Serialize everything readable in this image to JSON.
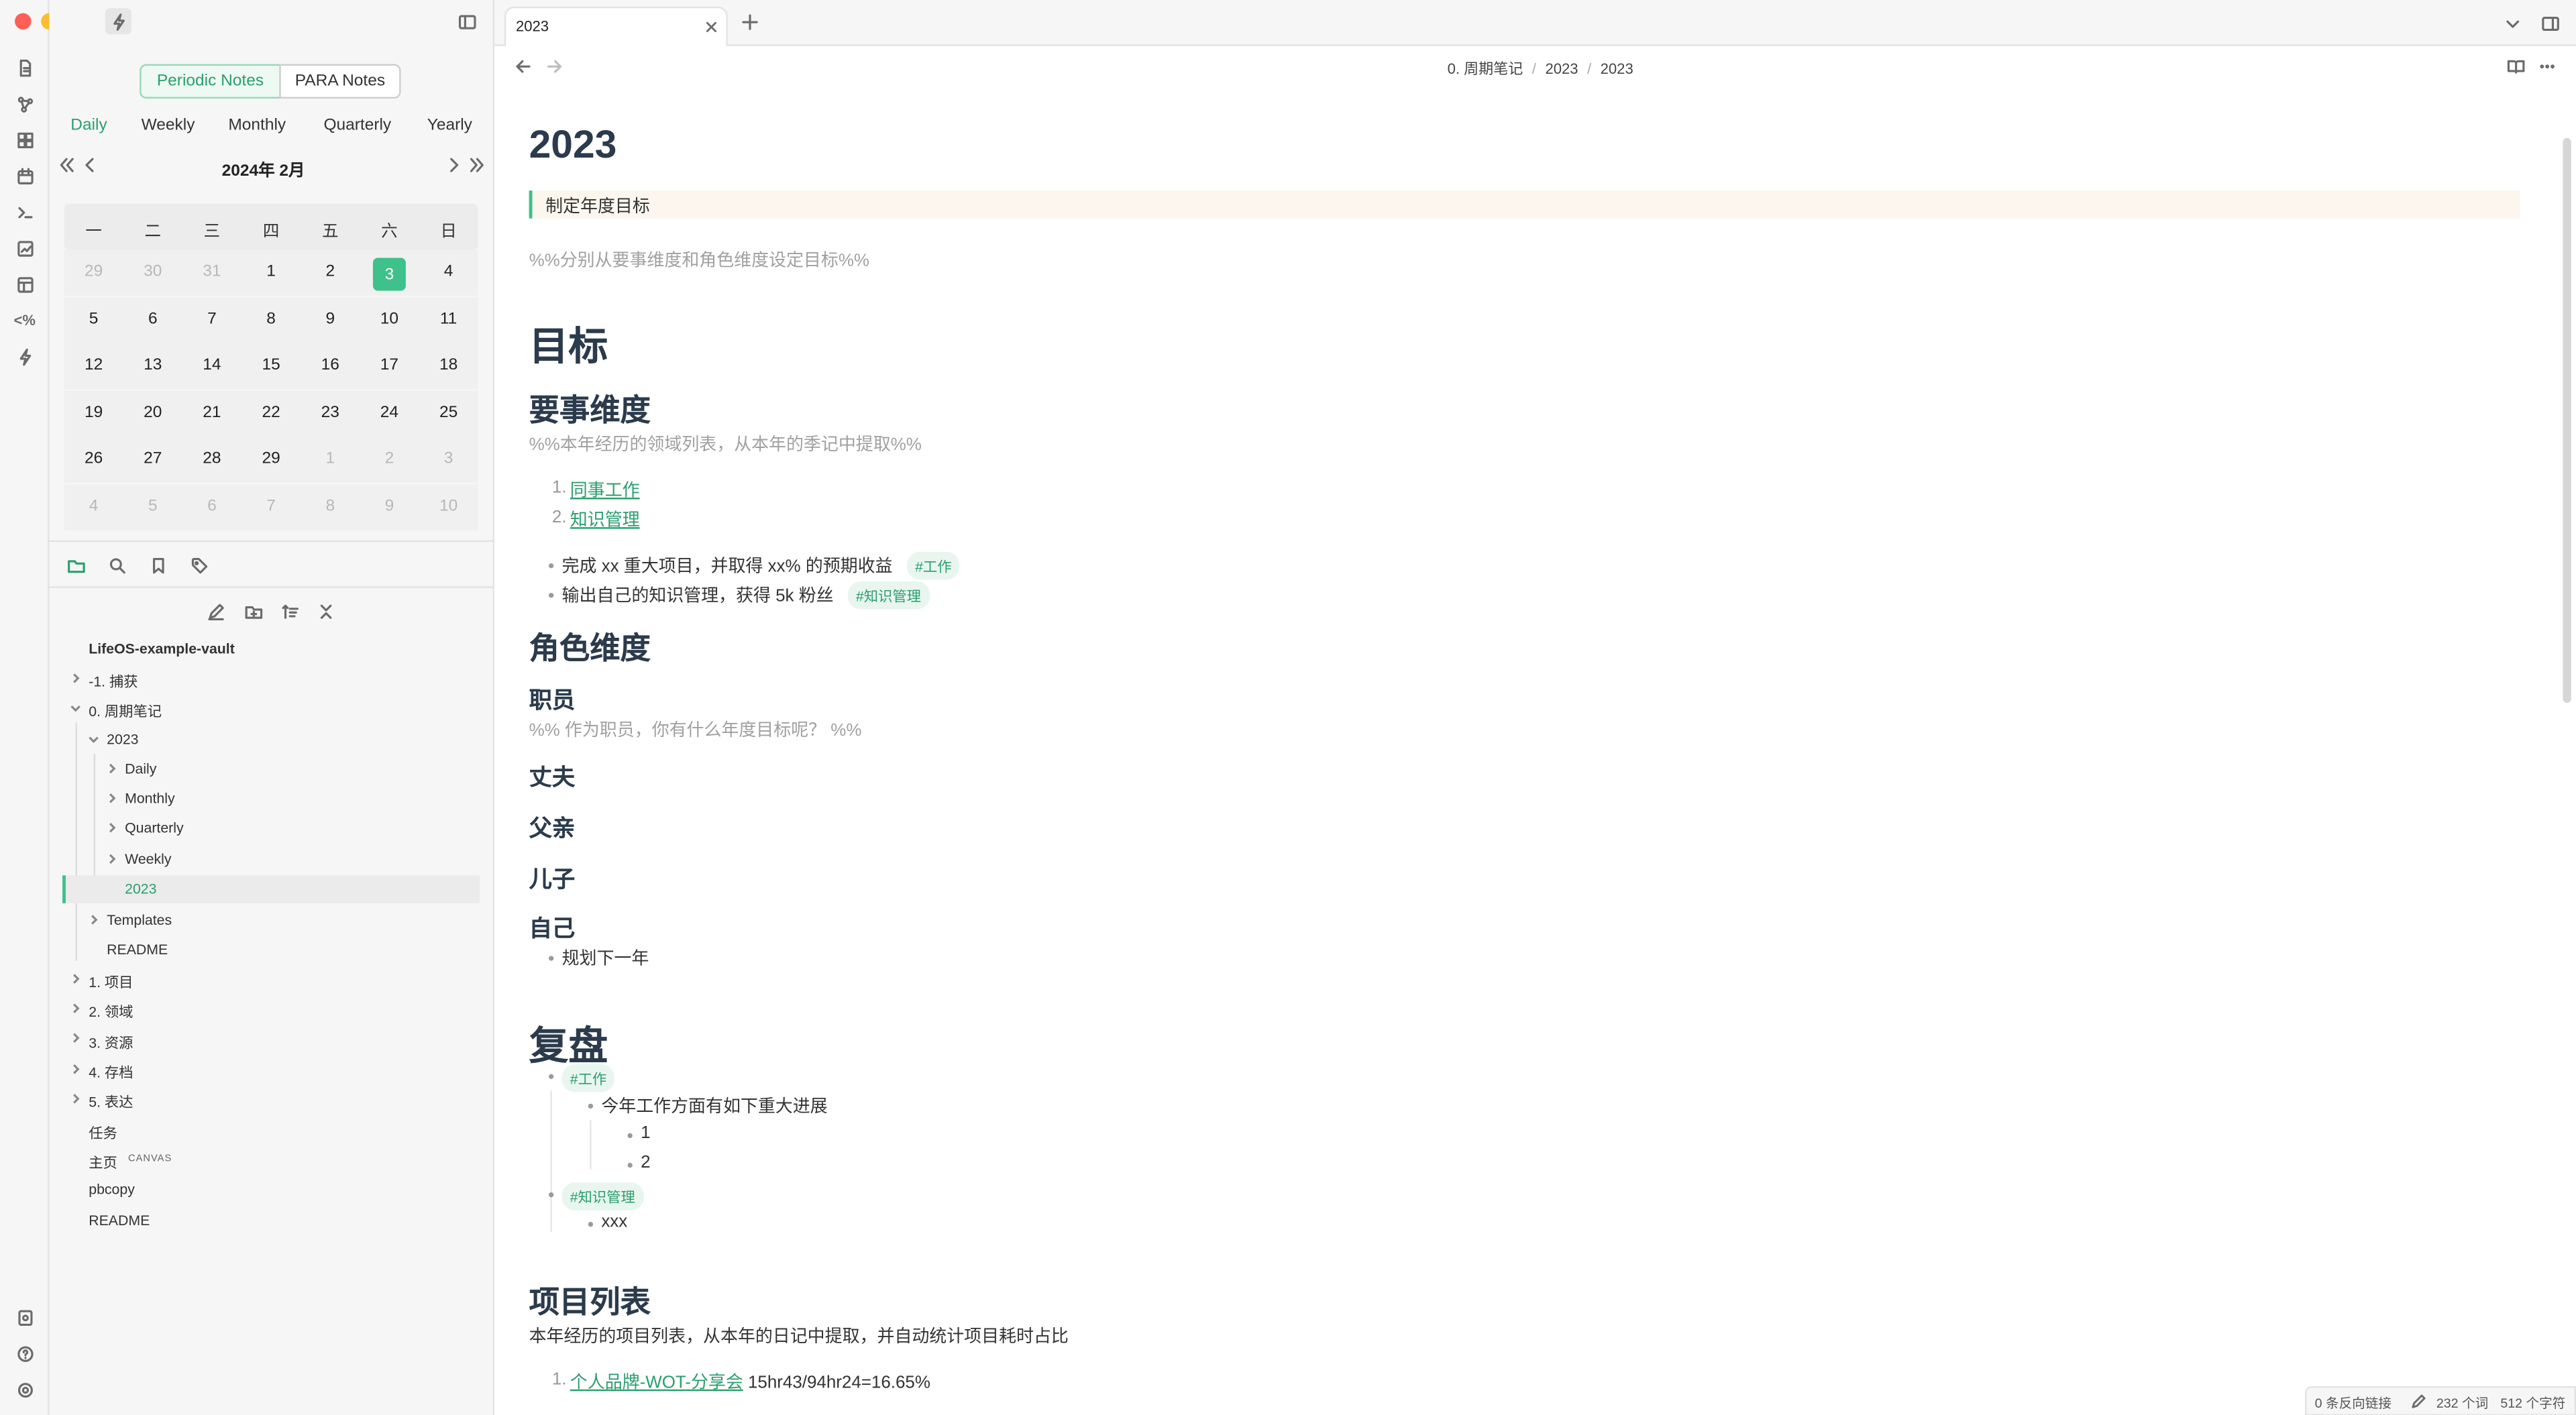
{
  "sidebar": {
    "view_toggle": [
      "Periodic Notes",
      "PARA Notes"
    ],
    "periods": [
      "Daily",
      "Weekly",
      "Monthly",
      "Quarterly",
      "Yearly"
    ],
    "calendar": {
      "month_label": "2024年  2月",
      "weekdays": [
        "一",
        "二",
        "三",
        "四",
        "五",
        "六",
        "日"
      ],
      "weeks": [
        [
          "29",
          "30",
          "31",
          "1",
          "2",
          "3",
          "4"
        ],
        [
          "5",
          "6",
          "7",
          "8",
          "9",
          "10",
          "11"
        ],
        [
          "12",
          "13",
          "14",
          "15",
          "16",
          "17",
          "18"
        ],
        [
          "19",
          "20",
          "21",
          "22",
          "23",
          "24",
          "25"
        ],
        [
          "26",
          "27",
          "28",
          "29",
          "1",
          "2",
          "3"
        ],
        [
          "4",
          "5",
          "6",
          "7",
          "8",
          "9",
          "10"
        ]
      ],
      "today": "3"
    },
    "tree": {
      "vault": "LifeOS-example-vault",
      "capture": "-1. 捕获",
      "periodic": "0. 周期笔记",
      "year_folder": "2023",
      "daily": "Daily",
      "monthly": "Monthly",
      "quarterly": "Quarterly",
      "weekly": "Weekly",
      "year_note": "2023",
      "templates": "Templates",
      "readme_inner": "README",
      "projects": "1. 项目",
      "areas": "2. 领域",
      "resources": "3. 资源",
      "archive": "4. 存档",
      "express": "5. 表达",
      "tasks": "任务",
      "home": "主页",
      "canvas_badge": "CANVAS",
      "pbcopy": "pbcopy",
      "readme": "README"
    }
  },
  "tabs": {
    "active": "2023"
  },
  "breadcrumb": [
    "0. 周期笔记",
    "2023",
    "2023"
  ],
  "doc": {
    "title": "2023",
    "callout": "制定年度目标",
    "comment1": "%%分别从要事维度和角色维度设定目标%%",
    "h_goals": "目标",
    "h_key": "要事维度",
    "comment2": "%%本年经历的领域列表，从本年的季记中提取%%",
    "ol1": "同事工作",
    "ol2": "知识管理",
    "bullet1": "完成 xx 重大项目，并取得 xx% 的预期收益",
    "tag_work": "#工作",
    "bullet2": "输出自己的知识管理，获得 5k 粉丝",
    "tag_km": "#知识管理",
    "h_role": "角色维度",
    "role_staff": "职员",
    "comment3": "%% 作为职员，你有什么年度目标呢？ %%",
    "role_husband": "丈夫",
    "role_father": "父亲",
    "role_son": "儿子",
    "role_self": "自己",
    "self_bullet": "规划下一年",
    "h_review": "复盘",
    "review_tag1": "#工作",
    "review_text1": "今年工作方面有如下重大进展",
    "review_n1": "1",
    "review_n2": "2",
    "review_tag2": "#知识管理",
    "review_text2": "xxx",
    "h_projects": "项目列表",
    "projects_desc": "本年经历的项目列表，从本年的日记中提取，并自动统计项目耗时占比",
    "project1_link": "个人品牌-WOT-分享会",
    "project1_stat": " 15hr43/94hr24=16.65%",
    "ol_prefix1": "1.",
    "ol_prefix2": "2."
  },
  "status": {
    "backlinks": "0 条反向链接",
    "words": "232 个词",
    "chars": "512 个字符"
  },
  "colors": {
    "accent": "#3ec18b",
    "link": "#2a9e6f",
    "heading": "#2b3b4c"
  }
}
